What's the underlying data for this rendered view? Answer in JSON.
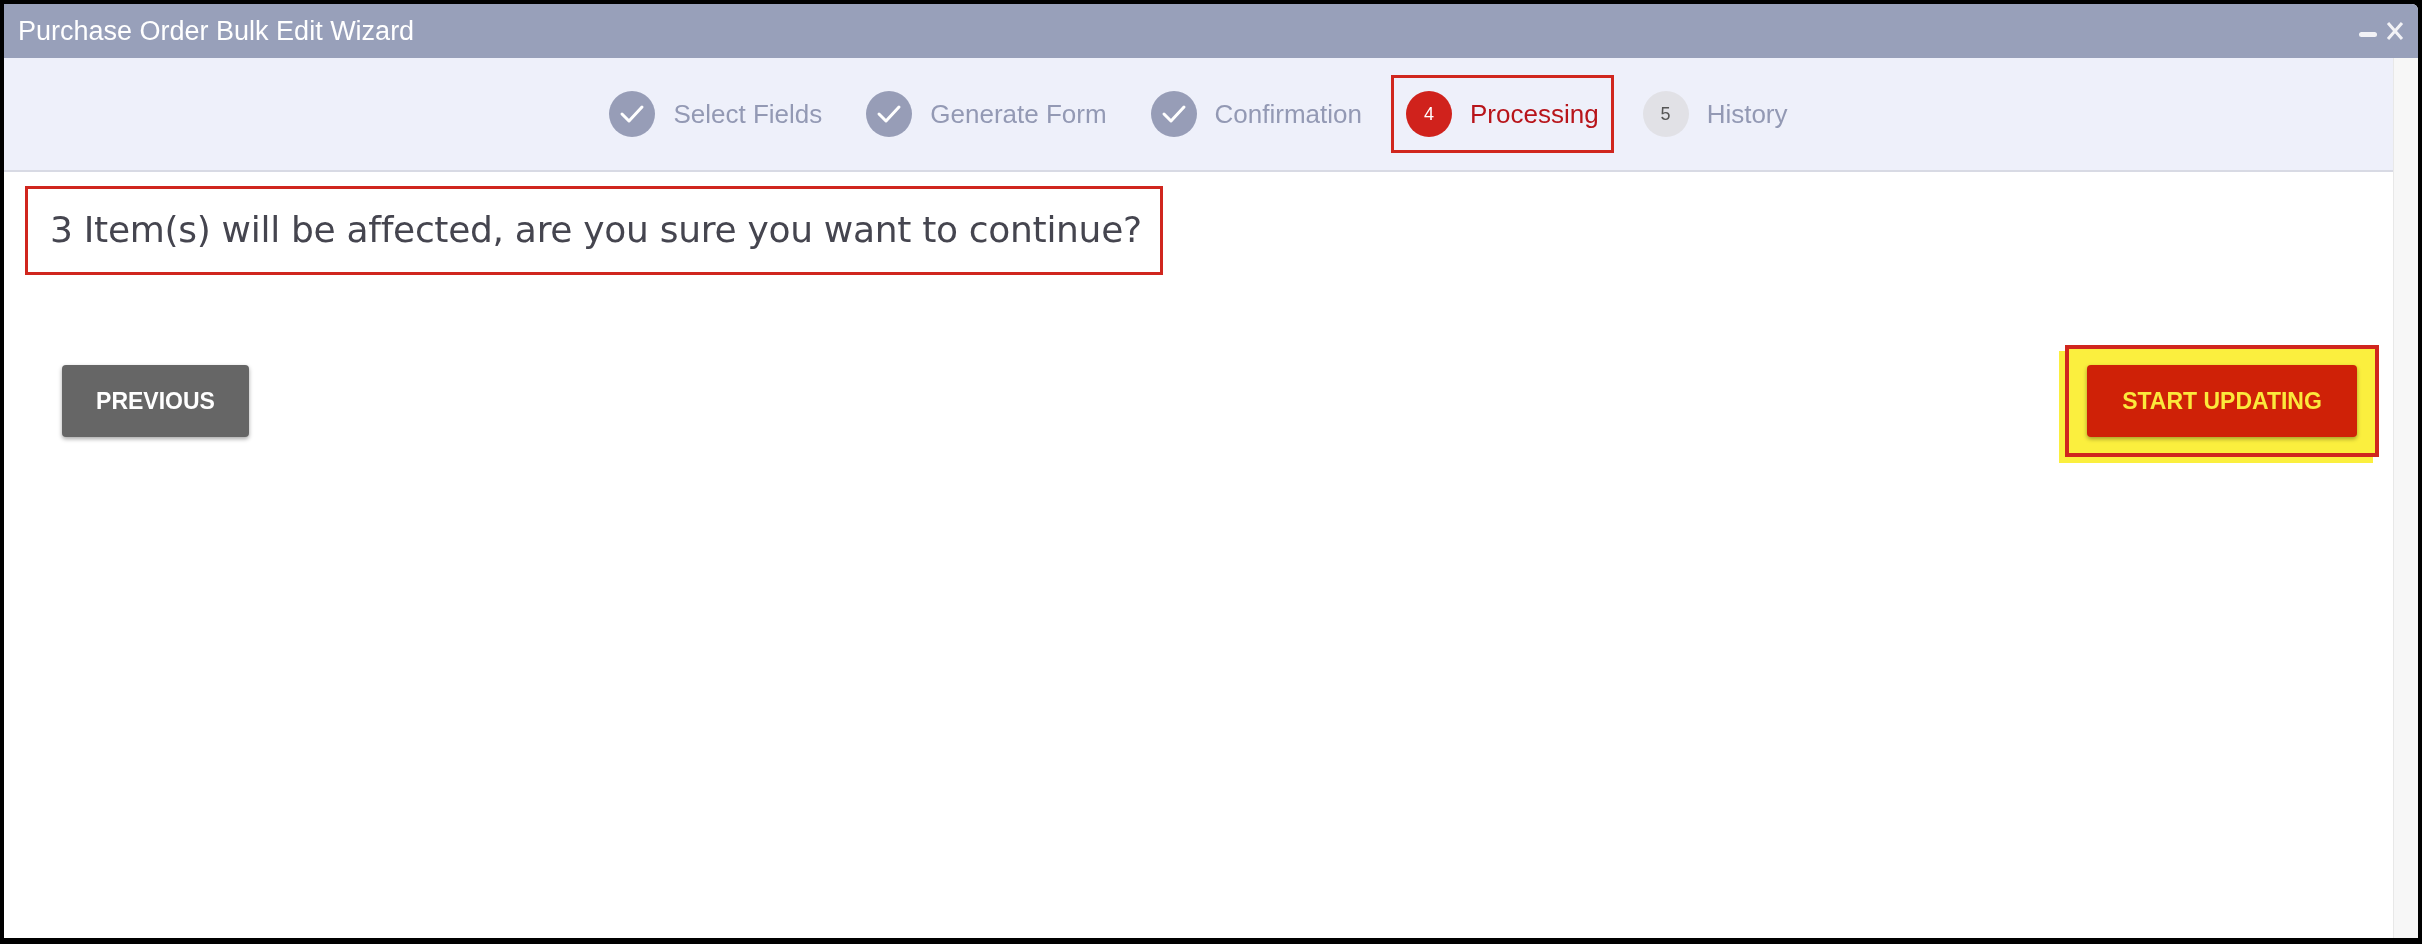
{
  "window": {
    "title": "Purchase Order Bulk Edit Wizard",
    "controls": [
      {
        "kind": "minimize"
      },
      {
        "kind": "close"
      }
    ]
  },
  "steps": [
    {
      "label": "Select Fields",
      "kind": "check",
      "selected": false,
      "highlighted": false
    },
    {
      "label": "Generate Form",
      "kind": "check",
      "selected": false,
      "highlighted": false
    },
    {
      "label": "Confirmation",
      "kind": "check",
      "selected": false,
      "highlighted": false
    },
    {
      "label": "Processing",
      "number": "4",
      "kind": "number",
      "selected": true,
      "highlighted": true
    },
    {
      "label": "History",
      "number": "5",
      "kind": "number",
      "selected": false,
      "highlighted": false
    }
  ],
  "message": {
    "text": "3 Item(s) will be affected, are you sure you want to continue?",
    "highlighted": true
  },
  "buttons": [
    {
      "label": "PREVIOUS",
      "kind": "secondary",
      "highlighted": false
    },
    {
      "label": "START UPDATING",
      "kind": "primary",
      "highlighted": true
    }
  ]
}
